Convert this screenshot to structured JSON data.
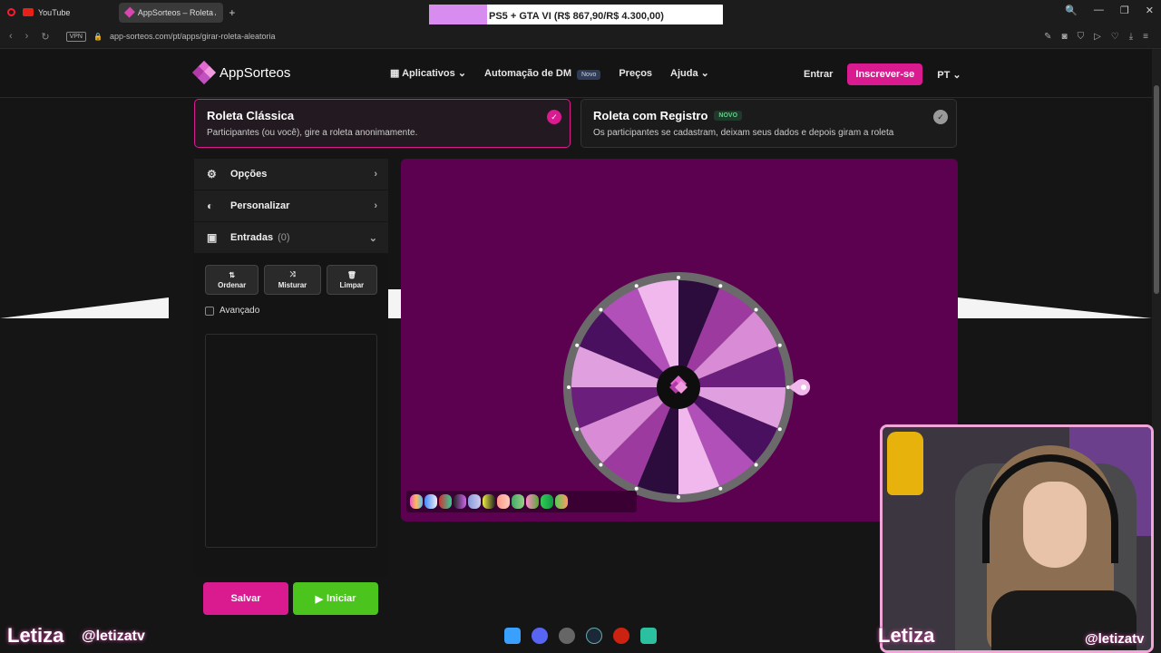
{
  "browser": {
    "tabs": [
      {
        "label": "YouTube"
      },
      {
        "label": "AppSorteos – Roleta Alea"
      }
    ],
    "new_tab": "+",
    "url": "app-sorteos.com/pt/apps/girar-roleta-aleatoria",
    "vpn": "VPN",
    "window_controls": [
      "🔍",
      "—",
      "❐",
      "✕"
    ]
  },
  "stream_banner": "PS5 + GTA VI (R$ 867,90/R$ 4.300,00)",
  "header": {
    "logo": "AppSorteos",
    "nav": {
      "apps": "Aplicativos",
      "dm": "Automação de DM",
      "dm_badge": "Novo",
      "prices": "Preços",
      "help": "Ajuda"
    },
    "login": "Entrar",
    "signup": "Inscrever-se",
    "lang": "PT"
  },
  "modes": [
    {
      "title": "Roleta Clássica",
      "desc": "Participantes (ou você), gire a roleta anonimamente.",
      "selected": true
    },
    {
      "title": "Roleta com Registro",
      "badge": "NOVO",
      "desc": "Os participantes se cadastram, deixam seus dados e depois giram a roleta",
      "selected": false
    }
  ],
  "sidebar": {
    "options": "Opções",
    "customize": "Personalizar",
    "entries": "Entradas",
    "entries_count": "(0)",
    "tools": {
      "sort": "Ordenar",
      "shuffle": "Misturar",
      "clear": "Limpar"
    },
    "advanced": "Avançado"
  },
  "actions": {
    "save": "Salvar",
    "start": "Iniciar"
  },
  "wheel": {
    "colors": [
      "#2c0c3c",
      "#9c3aa0",
      "#d98bd6",
      "#6c1e7c",
      "#e0a0e0",
      "#4a1060",
      "#b050b8",
      "#f0b8ec"
    ],
    "rim": "#6a6a6a"
  },
  "overlay": {
    "name_left": "Letiza",
    "handle_left": "@letizatv",
    "name_right": "Letiza",
    "handle_right": "@letizatv"
  }
}
